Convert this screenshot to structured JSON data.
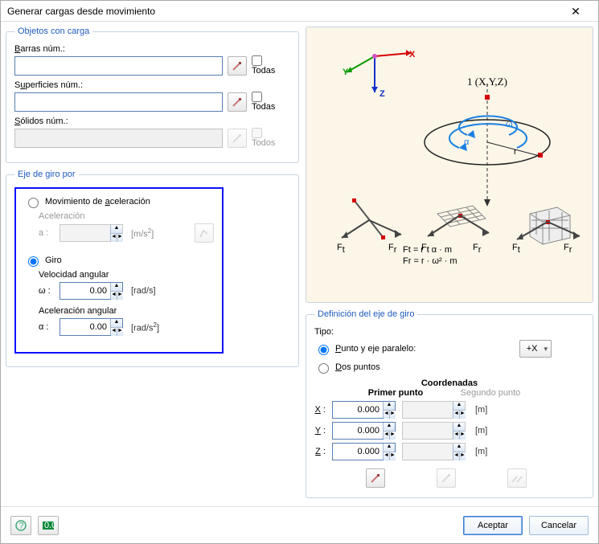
{
  "window": {
    "title": "Generar cargas desde movimiento"
  },
  "objects": {
    "legend": "Objetos con carga",
    "bars_label": "Barras núm.:",
    "bars_value": "",
    "bars_all": "Todas",
    "surfaces_label": "Superficies núm.:",
    "surfaces_value": "",
    "surfaces_all": "Todas",
    "solids_label": "Sólidos núm.:",
    "solids_value": "",
    "solids_all": "Todos"
  },
  "axis_mode": {
    "legend": "Eje de giro por",
    "accel_option": "Movimiento de aceleración",
    "accel_sublabel": "Aceleración",
    "accel_symbol": "a :",
    "accel_value": "",
    "accel_unit": "[m/s²]",
    "rotation_option": "Giro",
    "ang_vel_label": "Velocidad angular",
    "ang_vel_symbol": "ω :",
    "ang_vel_value": "0.00",
    "ang_vel_unit": "[rad/s]",
    "ang_acc_label": "Aceleración angular",
    "ang_acc_symbol": "α :",
    "ang_acc_value": "0.00",
    "ang_acc_unit": "[rad/s²]"
  },
  "diagram": {
    "point_label": "1 (X,Y,Z)",
    "omega": "ω",
    "alpha": "α",
    "r": "r",
    "ft": "Ft",
    "fr": "Fr",
    "formula1": "Ft = r · α · m",
    "formula2": "Fr = r · ω² · m"
  },
  "axis_def": {
    "legend": "Definición del eje de giro",
    "type_label": "Tipo:",
    "opt_parallel": "Punto y eje paralelo:",
    "opt_two_points": "Dos puntos",
    "axis_select": "+X",
    "coord_title": "Coordenadas",
    "primary_header": "Primer punto",
    "secondary_header": "Segundo punto",
    "x_label": "X :",
    "y_label": "Y :",
    "z_label": "Z :",
    "x1": "0.000",
    "y1": "0.000",
    "z1": "0.000",
    "x2": "",
    "y2": "",
    "z2": "",
    "unit_m": "[m]"
  },
  "footer": {
    "ok": "Aceptar",
    "cancel": "Cancelar"
  }
}
